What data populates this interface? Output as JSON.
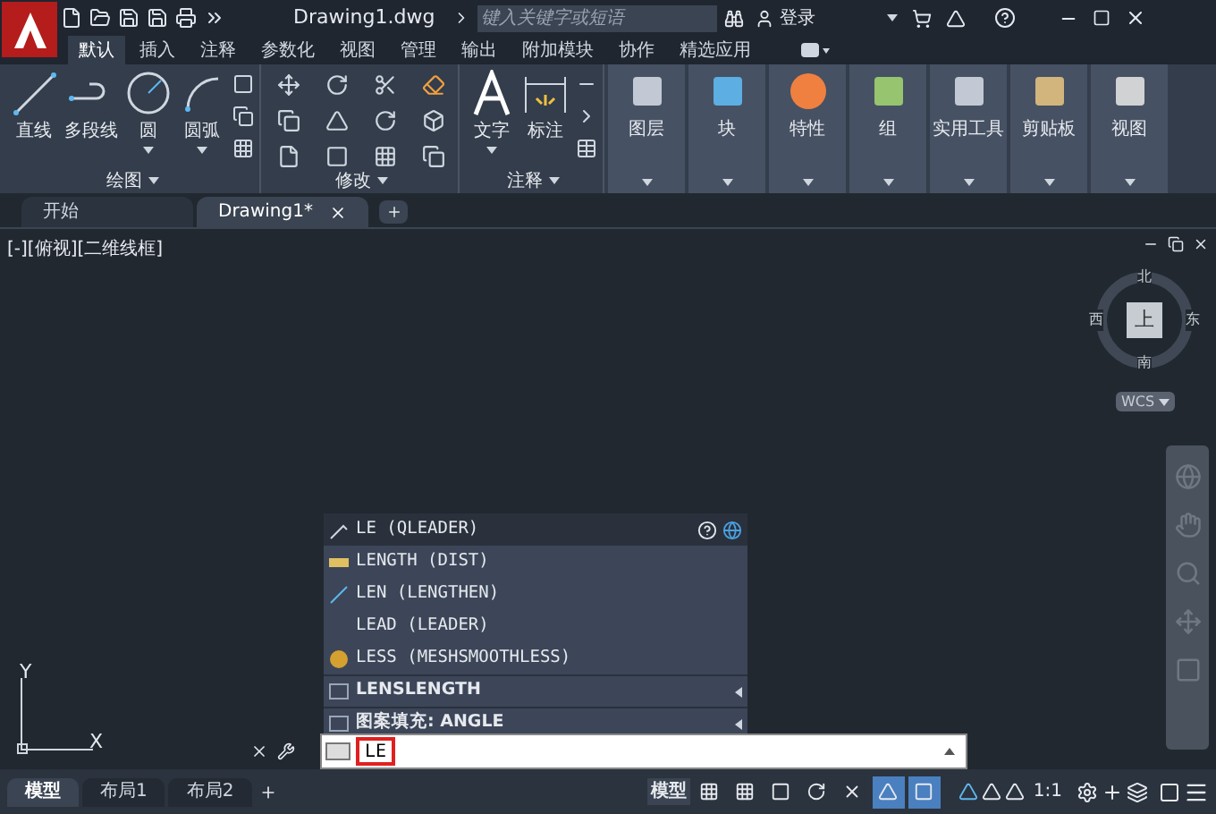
{
  "title_bar": {
    "file_name": "Drawing1.dwg",
    "search_placeholder": "键入关键字或短语",
    "login": "登录"
  },
  "ribbon_tabs": [
    {
      "label": "默认",
      "selected": true
    },
    {
      "label": "插入",
      "selected": false
    },
    {
      "label": "注释",
      "selected": false
    },
    {
      "label": "参数化",
      "selected": false
    },
    {
      "label": "视图",
      "selected": false
    },
    {
      "label": "管理",
      "selected": false
    },
    {
      "label": "输出",
      "selected": false
    },
    {
      "label": "附加模块",
      "selected": false
    },
    {
      "label": "协作",
      "selected": false
    },
    {
      "label": "精选应用",
      "selected": false
    }
  ],
  "ribbon_groups": [
    {
      "title": "绘图",
      "large_buttons": [
        {
          "label": "直线",
          "dropdown": false
        },
        {
          "label": "多段线",
          "dropdown": false
        },
        {
          "label": "圆",
          "dropdown": true
        },
        {
          "label": "圆弧",
          "dropdown": true
        }
      ]
    },
    {
      "title": "修改"
    },
    {
      "title": "注释",
      "large_buttons": [
        {
          "label": "文字",
          "dropdown": true
        },
        {
          "label": "标注",
          "dropdown": false
        }
      ]
    }
  ],
  "ribbon_panels": [
    {
      "label": "图层"
    },
    {
      "label": "块"
    },
    {
      "label": "特性"
    },
    {
      "label": "组"
    },
    {
      "label": "实用工具"
    },
    {
      "label": "剪贴板"
    },
    {
      "label": "视图"
    }
  ],
  "file_tabs": [
    {
      "label": "开始",
      "selected": false,
      "closable": false
    },
    {
      "label": "Drawing1*",
      "selected": true,
      "closable": true
    }
  ],
  "viewport_label": "[-][俯视][二维线框]",
  "viewcube": {
    "top": "上",
    "north": "北",
    "south": "南",
    "east": "东",
    "west": "西",
    "ucs": "WCS"
  },
  "axis": {
    "x": "X",
    "y": "Y"
  },
  "autocomplete": [
    {
      "text": "LE (QLEADER)",
      "kind": "command",
      "selected": true
    },
    {
      "text": "LENGTH (DIST)",
      "kind": "command",
      "selected": false
    },
    {
      "text": "LEN (LENGTHEN)",
      "kind": "command",
      "selected": false
    },
    {
      "text": "LEAD (LEADER)",
      "kind": "command",
      "selected": false
    },
    {
      "text": "LESS (MESHSMOOTHLESS)",
      "kind": "command",
      "selected": false
    },
    {
      "text": "LENSLENGTH",
      "kind": "variable",
      "selected": false
    },
    {
      "text": "图案填充: ANGLE",
      "kind": "variable",
      "selected": false
    }
  ],
  "command_line": {
    "value": "LE"
  },
  "layout_tabs": [
    {
      "label": "模型",
      "selected": true
    },
    {
      "label": "布局1",
      "selected": false
    },
    {
      "label": "布局2",
      "selected": false
    }
  ],
  "status_bar": {
    "space": "模型",
    "scale": "1:1",
    "toggles": [
      {
        "on": false
      },
      {
        "on": false
      },
      {
        "on": false
      },
      {
        "on": false
      },
      {
        "on": false
      },
      {
        "on": true
      },
      {
        "on": true
      }
    ]
  }
}
